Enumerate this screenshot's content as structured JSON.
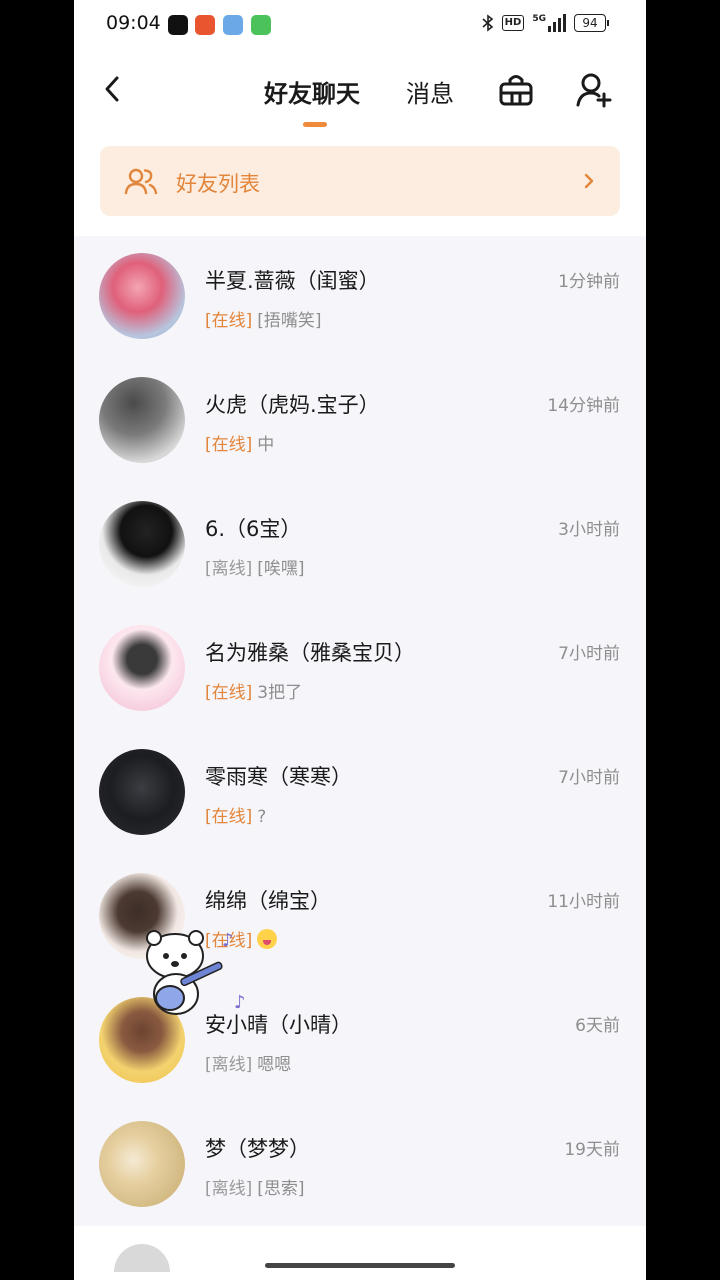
{
  "status_bar": {
    "time": "09:04",
    "network": "HD",
    "signal": "5G",
    "battery": "94"
  },
  "nav": {
    "tab_friends": "好友聊天",
    "tab_messages": "消息",
    "active_tab": "好友聊天",
    "back_icon": "chevron-left-icon",
    "basket_icon": "basket-icon",
    "add_friend_icon": "add-user-icon"
  },
  "friend_list_banner": {
    "label": "好友列表",
    "icon": "users-icon"
  },
  "accent_color": "#ee8b3c",
  "chats": [
    {
      "name": "半夏.蔷薇（闺蜜）",
      "time": "1分钟前",
      "status": "[在线]",
      "online": true,
      "preview": "[捂嘴笑]"
    },
    {
      "name": "火虎（虎妈.宝子）",
      "time": "14分钟前",
      "status": "[在线]",
      "online": true,
      "preview": "中"
    },
    {
      "name": "6.（6宝）",
      "time": "3小时前",
      "status": "[离线]",
      "online": false,
      "preview": "[唉嘿]"
    },
    {
      "name": "名为雅桑（雅桑宝贝）",
      "time": "7小时前",
      "status": "[在线]",
      "online": true,
      "preview": "3把了"
    },
    {
      "name": "零雨寒（寒寒）",
      "time": "7小时前",
      "status": "[在线]",
      "online": true,
      "preview": "?"
    },
    {
      "name": "绵绵（绵宝）",
      "time": "11小时前",
      "status": "[在线]",
      "online": true,
      "preview": ""
    },
    {
      "name": "安小晴（小晴）",
      "time": "6天前",
      "status": "[离线]",
      "online": false,
      "preview": "嗯嗯"
    },
    {
      "name": "梦（梦梦）",
      "time": "19天前",
      "status": "[离线]",
      "online": false,
      "preview": "[思索]"
    }
  ]
}
